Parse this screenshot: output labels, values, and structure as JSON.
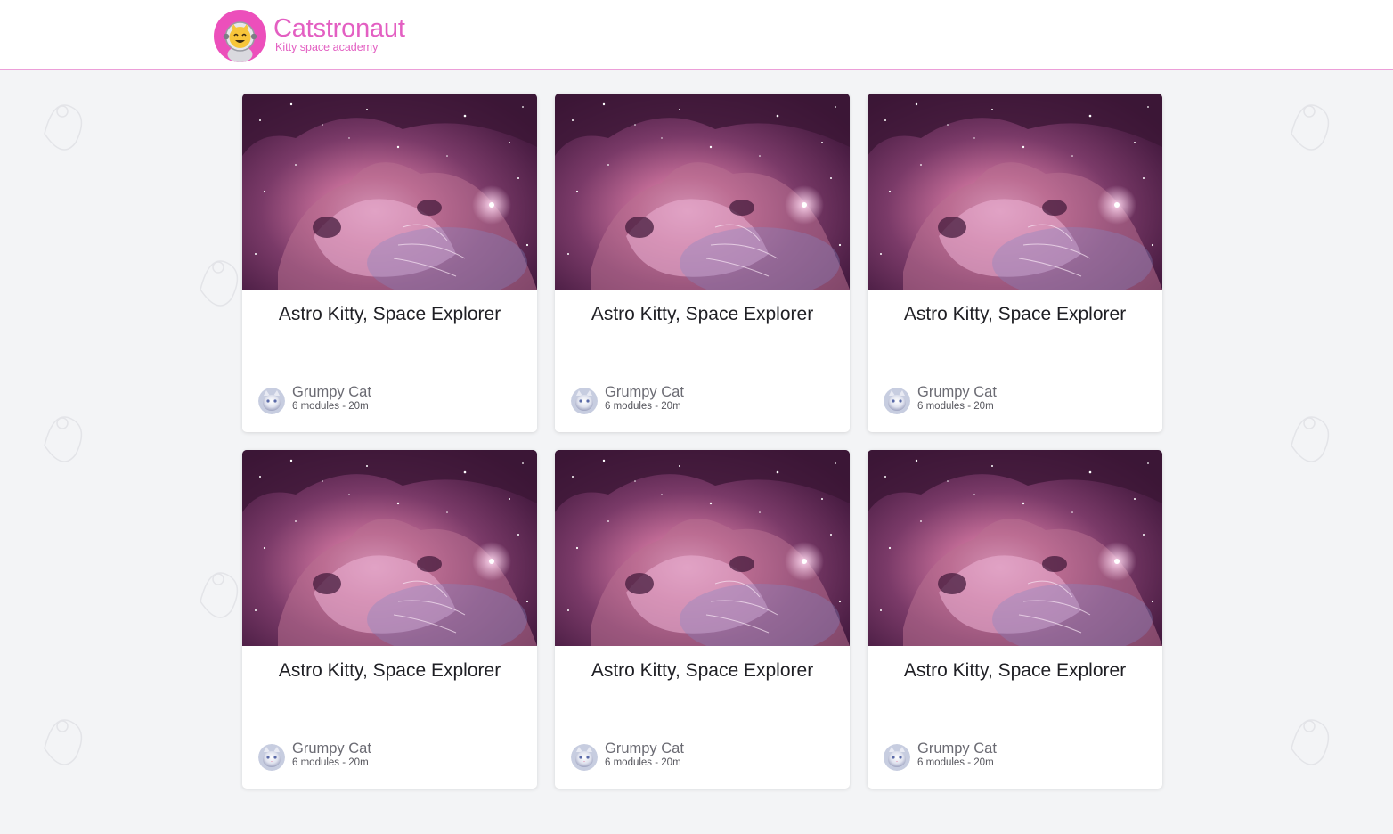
{
  "header": {
    "title": "Catstronaut",
    "subtitle": "Kitty space academy"
  },
  "colors": {
    "brand": "#e35fc2",
    "accent_border": "#ec9ed8",
    "background": "#f3f4f6"
  },
  "icons": {
    "logo": "astronaut-cat-icon",
    "avatar": "white-cat-avatar-icon"
  },
  "tracks": [
    {
      "title": "Astro Kitty, Space Explorer",
      "author": "Grumpy Cat",
      "meta": "6 modules - 20m"
    },
    {
      "title": "Astro Kitty, Space Explorer",
      "author": "Grumpy Cat",
      "meta": "6 modules - 20m"
    },
    {
      "title": "Astro Kitty, Space Explorer",
      "author": "Grumpy Cat",
      "meta": "6 modules - 20m"
    },
    {
      "title": "Astro Kitty, Space Explorer",
      "author": "Grumpy Cat",
      "meta": "6 modules - 20m"
    },
    {
      "title": "Astro Kitty, Space Explorer",
      "author": "Grumpy Cat",
      "meta": "6 modules - 20m"
    },
    {
      "title": "Astro Kitty, Space Explorer",
      "author": "Grumpy Cat",
      "meta": "6 modules - 20m"
    }
  ]
}
